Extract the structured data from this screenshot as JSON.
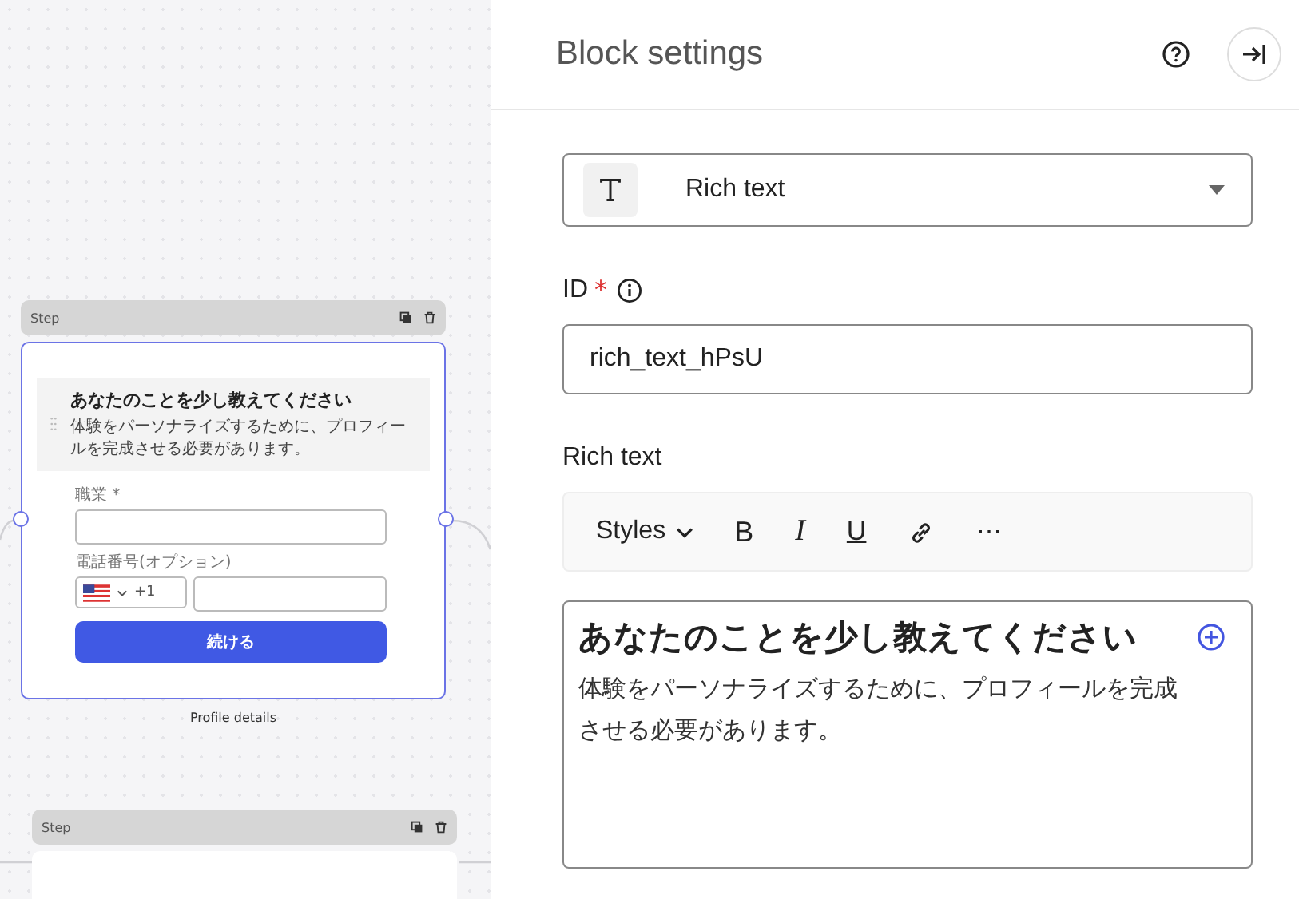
{
  "canvas": {
    "steps": [
      {
        "header": "Step",
        "selected": true,
        "caption": "Profile details",
        "preview": {
          "heading": "あなたのことを少し教えてください",
          "description": "体験をパーソナライズするために、プロフィールを完成させる必要があります。",
          "fields": [
            {
              "kind": "text",
              "label": "職業 *"
            },
            {
              "kind": "phone",
              "label": "電話番号(オプション)",
              "dial_code": "+1"
            }
          ],
          "button": "続ける"
        }
      },
      {
        "header": "Step",
        "selected": false
      }
    ]
  },
  "panel": {
    "title": "Block settings",
    "block_type": "Rich text",
    "id_label": "ID",
    "id_required_mark": "*",
    "id_value": "rich_text_hPsU",
    "rich_label": "Rich text",
    "toolbar": [
      {
        "kind": "dropdown",
        "label": "Styles"
      },
      {
        "kind": "bold",
        "label": "B"
      },
      {
        "kind": "italic",
        "label": "I"
      },
      {
        "kind": "underline",
        "label": "U"
      },
      {
        "kind": "link"
      },
      {
        "kind": "more",
        "label": "⋯"
      }
    ],
    "editor": {
      "heading": "あなたのことを少し教えてください",
      "body": "体験をパーソナライズするために、プロフィールを完成させる必要があります。"
    }
  }
}
